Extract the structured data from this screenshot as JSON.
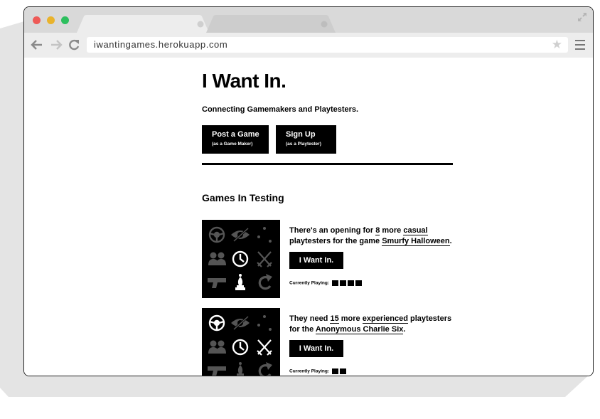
{
  "browser": {
    "url": "iwantingames.herokuapp.com",
    "colors": {
      "close": "#ee5a57",
      "minimize": "#e9b32c",
      "zoom": "#2dbf5e"
    }
  },
  "site": {
    "title": "I Want In.",
    "tagline": "Connecting Gamemakers and Playtesters.",
    "post_button": {
      "label": "Post a Game",
      "sub": "(as a Game Maker)"
    },
    "signup_button": {
      "label": "Sign Up",
      "sub": "(as a Playtester)"
    },
    "section_title": "Games In Testing"
  },
  "games": [
    {
      "intro": "There's an opening for",
      "count": "8",
      "more": "more",
      "type": "casual",
      "mid": "playtesters for the game",
      "game_name": "Smurfy Halloween",
      "end": ".",
      "button": "I Want In.",
      "playing_label": "Currently Playing:",
      "players": 4,
      "icons_highlighted": [
        "clock-icon",
        "chess-bishop-icon"
      ]
    },
    {
      "intro": "They need",
      "count": "15",
      "more": "more",
      "type": "experienced",
      "mid": "playtesters for the",
      "game_name": "Anonymous Charlie Six",
      "end": ".",
      "button": "I Want In.",
      "playing_label": "Currently Playing:",
      "players": 2,
      "icons_highlighted": [
        "steering-wheel-icon",
        "clock-icon",
        "crossed-swords-icon"
      ]
    }
  ]
}
